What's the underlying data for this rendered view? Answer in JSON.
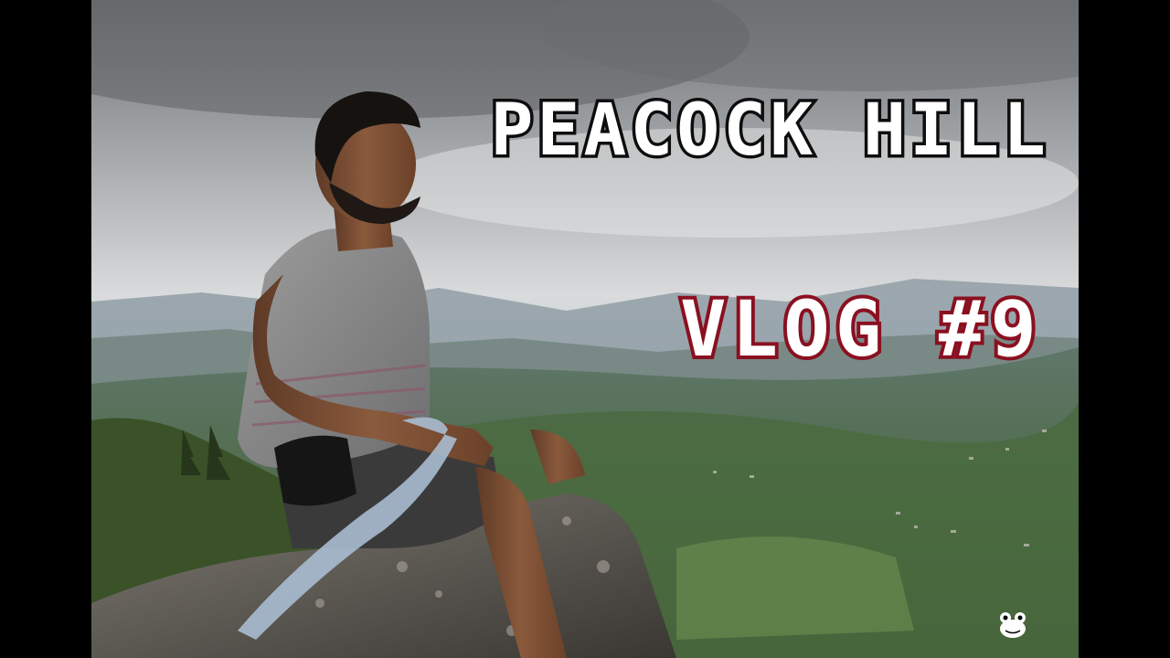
{
  "thumbnail": {
    "title_top": "PEACOCK HILL",
    "title_bottom": "VLOG #9",
    "watermark_icon": "frog-mascot-icon",
    "colors": {
      "title_top_outline": "#0d0d0d",
      "title_bottom_outline": "#8a1020",
      "title_fill": "#ffffff",
      "letterbox": "#000000"
    }
  }
}
